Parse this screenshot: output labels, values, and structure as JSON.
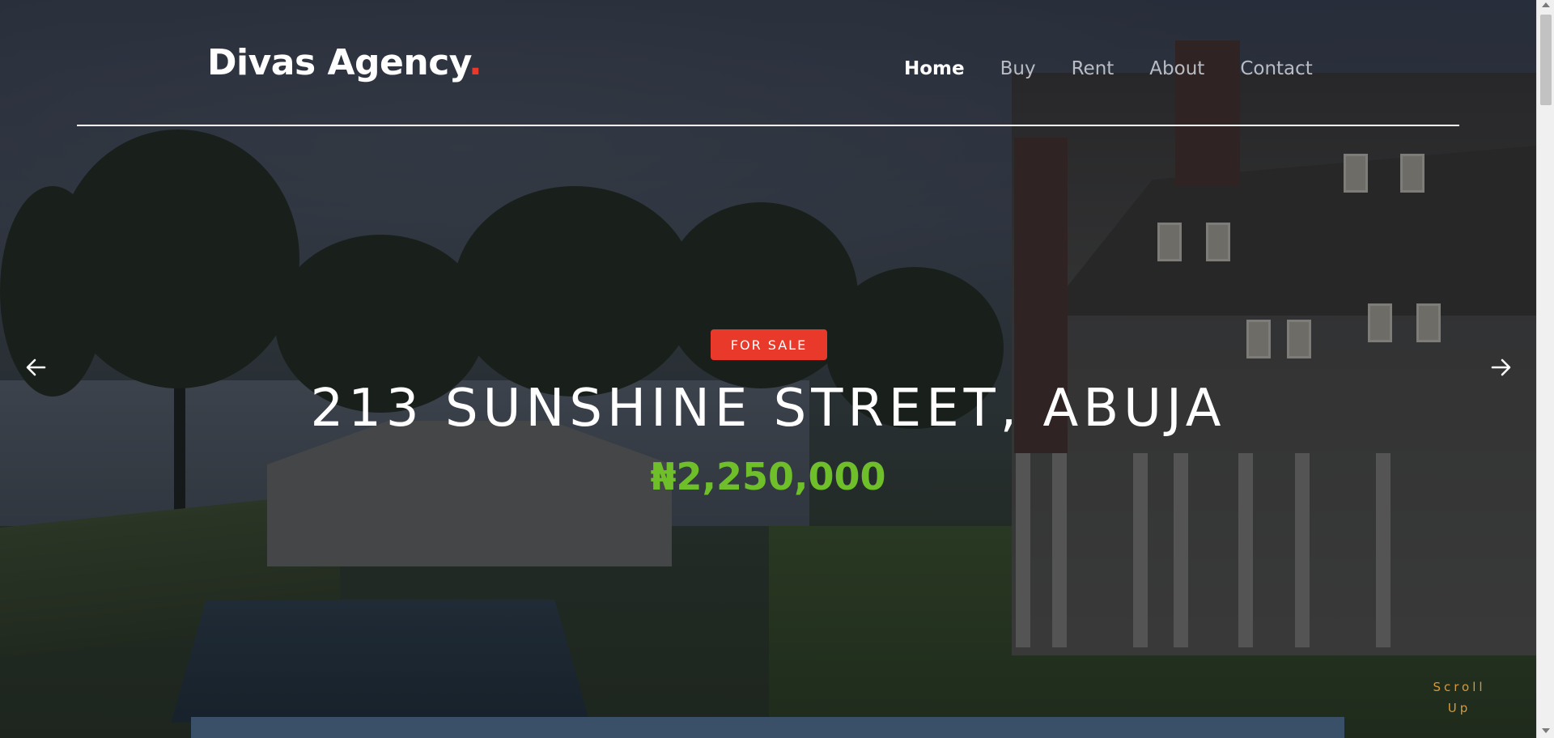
{
  "header": {
    "logo_text": "Divas Agency",
    "logo_dot": ".",
    "nav": [
      {
        "label": "Home",
        "active": true
      },
      {
        "label": "Buy",
        "active": false
      },
      {
        "label": "Rent",
        "active": false
      },
      {
        "label": "About",
        "active": false
      },
      {
        "label": "Contact",
        "active": false
      }
    ]
  },
  "hero": {
    "badge": "FOR SALE",
    "title": "213 SUNSHINE STREET, ABUJA",
    "price": "₦2,250,000",
    "prev_icon": "arrow-left-icon",
    "next_icon": "arrow-right-icon"
  },
  "scroll_up": {
    "line1": "Scroll",
    "line2": "Up"
  },
  "colors": {
    "accent": "#e8392b",
    "price": "#6fbf2a",
    "scroll_up": "#d59a3a",
    "bottom_bar": "#3a5069"
  }
}
